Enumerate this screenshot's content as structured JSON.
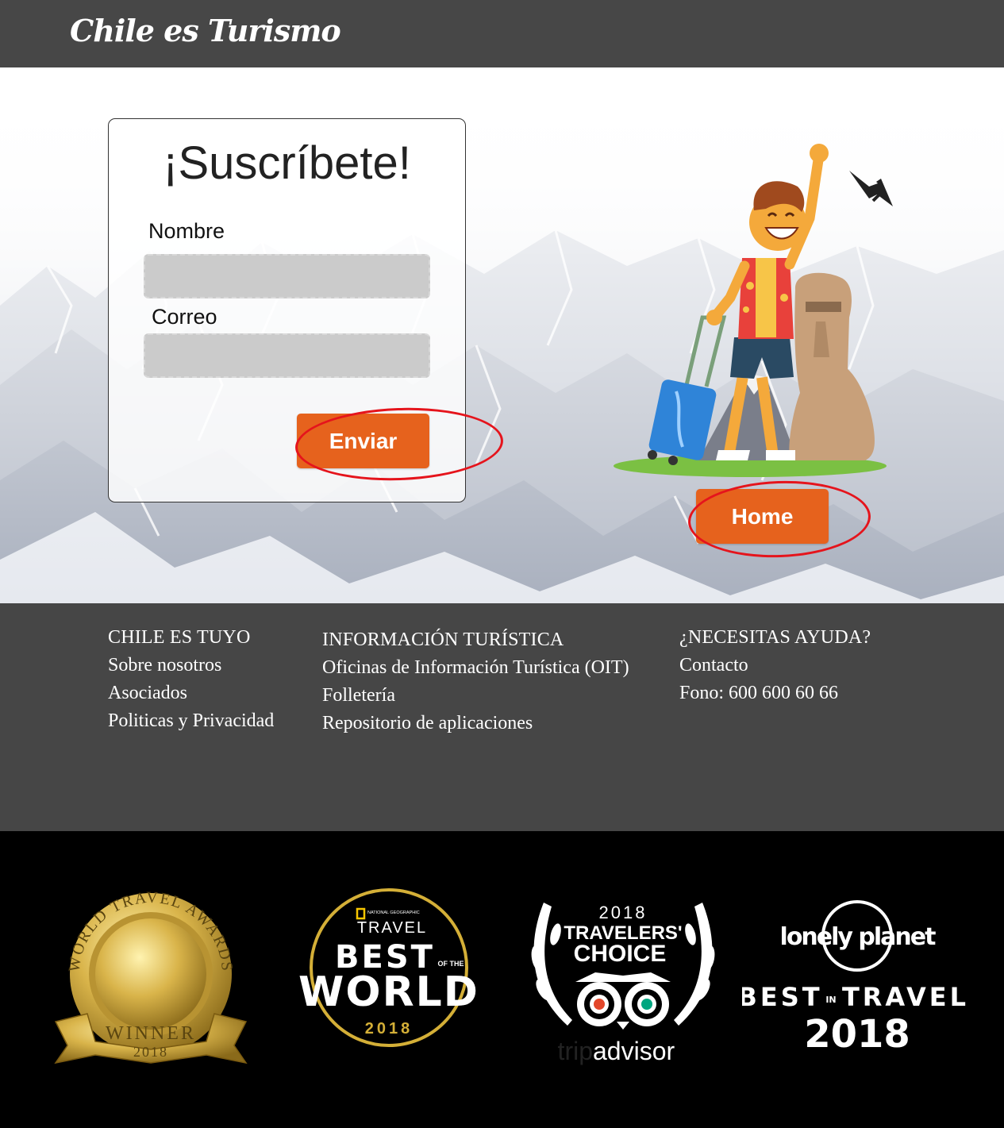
{
  "header": {
    "brand": "Chile es Turismo"
  },
  "form": {
    "title": "¡Suscríbete!",
    "name_label": "Nombre",
    "name_value": "",
    "email_label": "Correo",
    "email_value": "",
    "submit_label": "Enviar"
  },
  "home_button": "Home",
  "footer": {
    "col1": {
      "heading": "CHILE ES TUYO",
      "links": [
        "Sobre nosotros",
        "Asociados",
        "Politicas y Privacidad"
      ]
    },
    "col2": {
      "heading": "INFORMACIÓN TURÍSTICA",
      "links": [
        "Oficinas de Información Turística (OIT)",
        "Folletería",
        "Repositorio de aplicaciones"
      ]
    },
    "col3": {
      "heading": "¿NECESITAS AYUDA?",
      "links": [
        "Contacto",
        "Fono: 600 600 60 66"
      ]
    }
  },
  "awards": {
    "wta": {
      "ring_text": "WORLD TRAVEL AWARDS",
      "banner": "WINNER",
      "year": "2018"
    },
    "natgeo": {
      "publisher": "NATIONAL GEOGRAPHIC",
      "travel": "TRAVEL",
      "best": "BEST",
      "ofthe": "OF THE",
      "world": "WORLD",
      "year": "2018"
    },
    "tripadvisor": {
      "year": "2018",
      "line1": "TRAVELERS'",
      "line2": "CHOICE",
      "brand_trip": "trip",
      "brand_advisor": "advisor"
    },
    "lonelyplanet": {
      "brand": "lonely planet",
      "best": "BEST",
      "in": "IN",
      "travel": "TRAVEL",
      "year": "2018"
    }
  },
  "colors": {
    "accent": "#e6621d",
    "header_bg": "#474747",
    "footer_bg": "#464646",
    "annotation": "#e5141c",
    "gold": "#d4af37"
  }
}
